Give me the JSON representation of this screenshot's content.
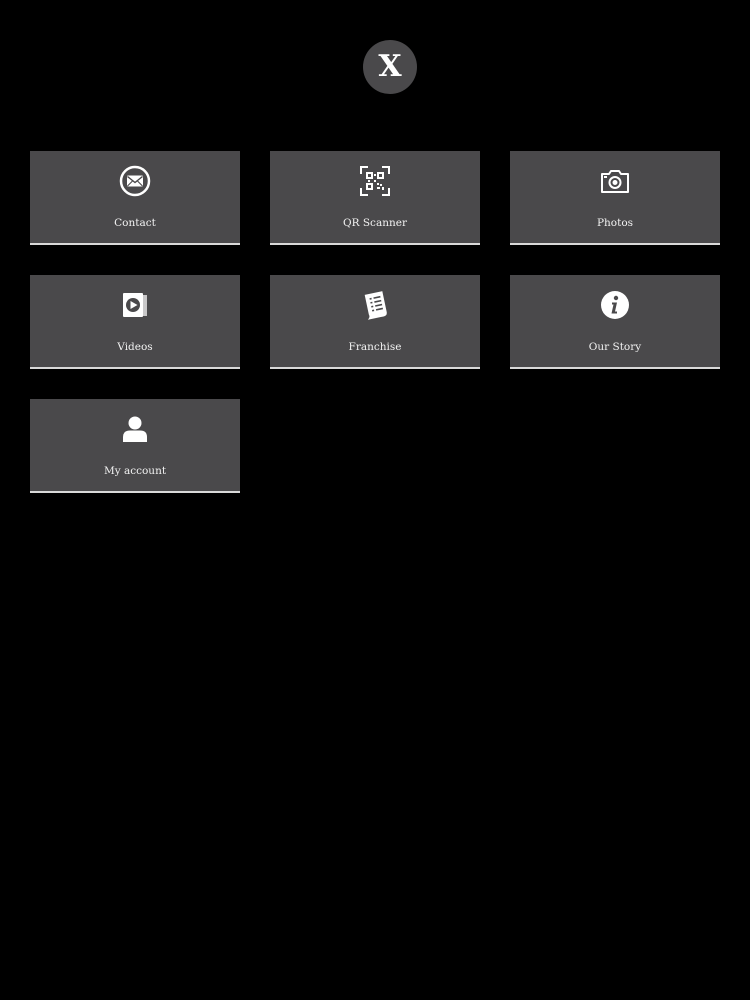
{
  "close_button": {
    "label": "X"
  },
  "menu": {
    "items": [
      {
        "label": "Contact",
        "icon": "envelope-icon"
      },
      {
        "label": "QR Scanner",
        "icon": "qr-code-icon"
      },
      {
        "label": "Photos",
        "icon": "camera-icon"
      },
      {
        "label": "Videos",
        "icon": "play-icon"
      },
      {
        "label": "Franchise",
        "icon": "document-icon"
      },
      {
        "label": "Our Story",
        "icon": "info-icon"
      },
      {
        "label": "My account",
        "icon": "user-icon"
      }
    ]
  },
  "colors": {
    "background": "#000000",
    "tile": "#4a494b",
    "tile_border": "#d9d9d9",
    "text": "#f2f2f2"
  }
}
